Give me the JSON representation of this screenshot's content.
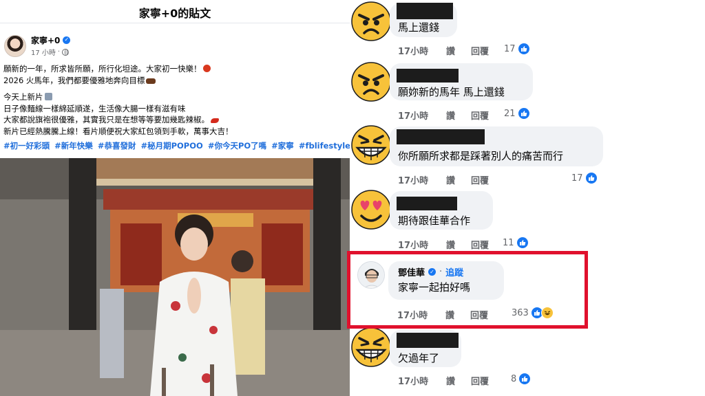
{
  "page_header": {
    "title": "家寧+0的貼文"
  },
  "post": {
    "author": "家寧+0",
    "time": "17 小時",
    "lines": [
      "願新的一年，所求皆所願，所行化坦途。大家初一快樂！",
      "2026 火馬年，我們都要優雅地奔向目標",
      "今天上新片",
      "日子像麵線一樣綿延順遂，生活像大腸一樣有滋有味",
      "大家都說旗袍很優雅，其實我只是在想等等要加幾匙辣椒。",
      "新片已經熱騰騰上線！看片順便祝大家紅包領到手軟，萬事大吉！"
    ],
    "hashtags": [
      "#初一好彩頭",
      "#新年快樂",
      "#恭喜發財",
      "#秘月期POPOO",
      "#你今天PO了嗎",
      "#家寧",
      "#fblifestyle"
    ]
  },
  "comment_actions": {
    "like": "讚",
    "reply": "回覆"
  },
  "comments": [
    {
      "emoji": "angry",
      "text": "馬上還錢",
      "time": "17小時",
      "reactions": "17"
    },
    {
      "emoji": "angry",
      "text": "願妳新的馬年 馬上還錢",
      "time": "17小時",
      "reactions": "21"
    },
    {
      "emoji": "grimace",
      "text": "你所願所求都是踩著別人的痛苦而行",
      "time": "17小時",
      "reactions": "17"
    },
    {
      "emoji": "heart-eyes",
      "text": "期待跟佳華合作",
      "time": "17小時",
      "reactions": "11"
    },
    {
      "emoji": "grimace",
      "text": "欠過年了",
      "time": "17小時",
      "reactions": "8"
    }
  ],
  "highlighted_reply": {
    "name": "鄧佳華",
    "follow": "追蹤",
    "separator": "·",
    "text": "家寧一起拍好嗎",
    "time": "17小時",
    "reactions": "363"
  },
  "colors": {
    "link": "#216fdb",
    "like_blue": "#1877f2",
    "highlight_red": "#e0112d",
    "bubble": "#f0f2f5",
    "emoji_yellow": "#f7c23a"
  }
}
